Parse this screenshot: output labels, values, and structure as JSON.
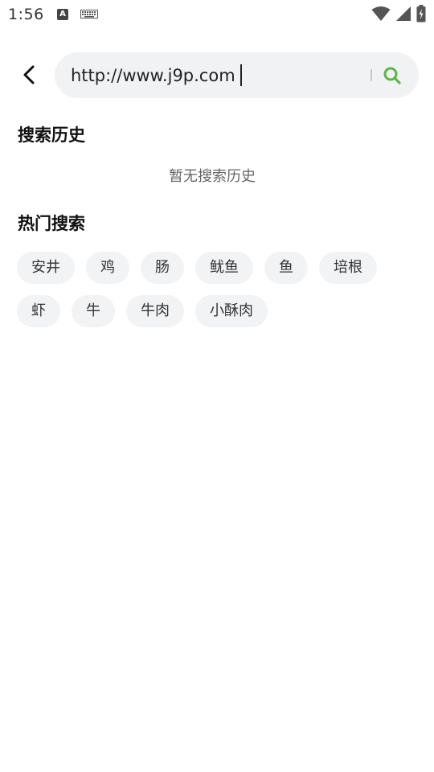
{
  "status_bar": {
    "time": "1:56",
    "input_indicator": "A"
  },
  "search": {
    "value": "http://www.j9p.com",
    "accent_color": "#5fb448"
  },
  "history": {
    "title": "搜索历史",
    "empty_text": "暂无搜索历史"
  },
  "hot": {
    "title": "热门搜索",
    "tags": [
      "安井",
      "鸡",
      "肠",
      "鱿鱼",
      "鱼",
      "培根",
      "虾",
      "牛",
      "牛肉",
      "小酥肉"
    ]
  },
  "icons": [
    "back-arrow-icon",
    "search-icon",
    "wifi-icon",
    "cellular-signal-icon",
    "battery-icon",
    "keyboard-icon"
  ]
}
